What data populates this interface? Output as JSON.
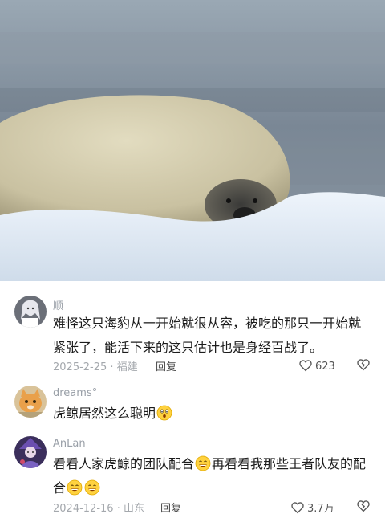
{
  "video": {
    "subject": "seal-on-ice"
  },
  "comments": [
    {
      "username": "顺",
      "text_lines": [
        "难怪这只海豹从一开始就很从容，被吃的那只一开始就",
        "紧张了，能活下来的这只估计也是身经百战了。"
      ],
      "date": "2025-2-25",
      "location": "福建",
      "reply_label": "回复",
      "likes": "623",
      "avatar_icon": "anime-girl-avatar"
    },
    {
      "username": "dreams°",
      "text": "虎鲸居然这么聪明",
      "emoji": "surprised-face-emoji",
      "avatar_icon": "orange-cat-avatar"
    },
    {
      "username": "AnLan",
      "text_part1": "看看人家虎鲸的团队配合",
      "text_part2": "再看看我那些王者队友的配",
      "text_part3": "合",
      "date": "2024-12-16",
      "location": "山东",
      "reply_label": "回复",
      "likes": "3.7万",
      "avatar_icon": "purple-character-avatar"
    }
  ],
  "colors": {
    "username": "#9aa0a8",
    "text": "#1c1c1c",
    "meta": "#a4a8ad"
  }
}
